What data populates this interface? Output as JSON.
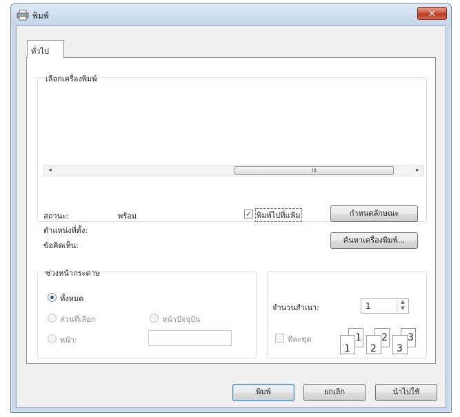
{
  "window": {
    "title": "พิมพ์",
    "close_glyph": "✕"
  },
  "tabs": [
    {
      "label": "ทั่วไป",
      "selected": true
    }
  ],
  "select_printer": {
    "legend": "เลือกเครื่องพิมพ์",
    "scrollbar": {
      "left_arrow": "◂",
      "right_arrow": "▸",
      "thumb_grip": "III"
    }
  },
  "printer_info": {
    "status_label": "สถานะ:",
    "status_value": "พร้อม",
    "location_label": "ตำแหน่งที่ตั้ง:",
    "comment_label": "ข้อคิดเห็น:",
    "print_to_file_label": "พิมพ์ไปที่แฟ้ม",
    "print_to_file_checked": true,
    "preferences_button": "กำหนดลักษณะ",
    "find_printer_button": "ค้นหาเครื่องพิมพ์..."
  },
  "page_range": {
    "legend": "ช่วงหน้ากระดาษ",
    "all_label": "ทั้งหมด",
    "selection_label": "ส่วนที่เลือก",
    "current_page_label": "หน้าปัจจุบัน",
    "pages_label": "หน้า:",
    "pages_value": "",
    "selected_option": "all"
  },
  "copies": {
    "number_label": "จำนวนสำเนา:",
    "number_value": "1",
    "spin_up": "▲",
    "spin_down": "▼",
    "collate_label": "ทีละชุด",
    "collate_checked": false,
    "collate_icon_numbers": [
      "1",
      "1",
      "2",
      "2",
      "3",
      "3"
    ]
  },
  "buttons": {
    "print": "พิมพ์",
    "cancel": "ยกเลิก",
    "apply": "นำไปใช้"
  },
  "colors": {
    "window_frame": "#c9d9ec",
    "close_button": "#c9523a",
    "radio_selected": "#1d5aa8"
  }
}
